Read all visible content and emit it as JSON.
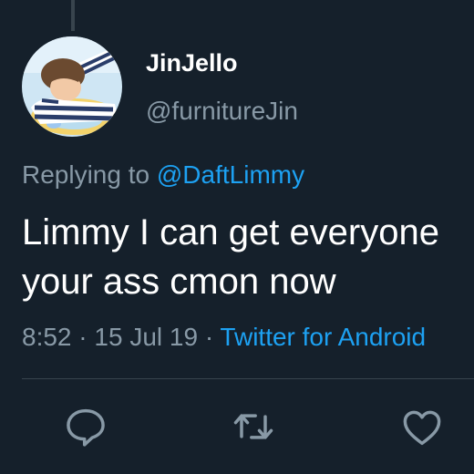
{
  "tweet": {
    "author": {
      "display_name": "JinJello",
      "handle": "@furnitureJin"
    },
    "replying_to": {
      "prefix": "Replying to",
      "mention": "@DaftLimmy"
    },
    "text_lines": [
      "Limmy I can get everyone",
      "your ass cmon now"
    ],
    "meta": {
      "time": "8:52",
      "sep1": "·",
      "date": "15 Jul 19",
      "sep2": "·",
      "source": "Twitter for Android"
    }
  },
  "actions": {
    "reply_icon": "speech-bubble-icon",
    "retweet_icon": "retweet-arrows-icon",
    "like_icon": "heart-outline-icon"
  },
  "colors": {
    "background": "#15202b",
    "primary_text": "#ffffff",
    "secondary_text": "#8899a6",
    "accent": "#1da1f2",
    "divider": "#38444d"
  }
}
